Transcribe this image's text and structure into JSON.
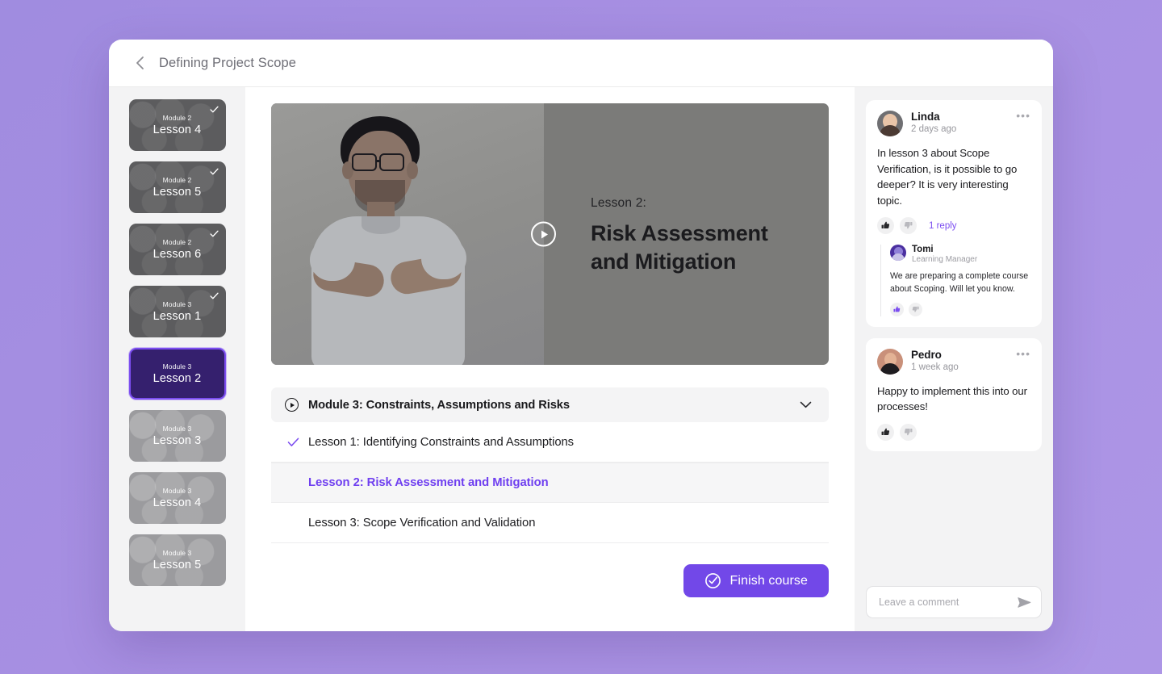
{
  "theme": {
    "page_background": "#a78fe2",
    "accent_purple": "#7248e8",
    "link_purple": "#7b4df0",
    "active_thumb_fill": "#35206e",
    "active_thumb_border": "#7b4df0",
    "sidebar_background": "#f3f3f4",
    "card_background": "#ffffff"
  },
  "header": {
    "back_icon": "chevron-left-icon",
    "title": "Defining Project Scope"
  },
  "sidebar": {
    "lessons": [
      {
        "module": "Module 2",
        "lesson": "Lesson 4",
        "state": "done"
      },
      {
        "module": "Module 2",
        "lesson": "Lesson 5",
        "state": "done"
      },
      {
        "module": "Module 2",
        "lesson": "Lesson 6",
        "state": "done"
      },
      {
        "module": "Module 3",
        "lesson": "Lesson 1",
        "state": "done"
      },
      {
        "module": "Module 3",
        "lesson": "Lesson 2",
        "state": "active"
      },
      {
        "module": "Module 3",
        "lesson": "Lesson 3",
        "state": "locked"
      },
      {
        "module": "Module 3",
        "lesson": "Lesson 4",
        "state": "locked"
      },
      {
        "module": "Module 3",
        "lesson": "Lesson 5",
        "state": "locked"
      }
    ]
  },
  "player": {
    "play_icon": "play-icon",
    "eyebrow": "Lesson 2:",
    "title_line1": "Risk Assessment",
    "title_line2": "and Mitigation"
  },
  "module": {
    "icon": "play-circle-icon",
    "title": "Module 3: Constraints, Assumptions and Risks",
    "toggle_icon": "chevron-down-icon",
    "lessons": [
      {
        "label": "Lesson 1: Identifying Constraints and Assumptions",
        "state": "completed"
      },
      {
        "label": "Lesson 2: Risk Assessment and Mitigation",
        "state": "current"
      },
      {
        "label": "Lesson 3: Scope Verification and Validation",
        "state": "upcoming"
      }
    ]
  },
  "footer": {
    "finish_icon": "circle-check-icon",
    "finish_label": "Finish course"
  },
  "comments": {
    "items": [
      {
        "author": "Linda",
        "time": "2 days ago",
        "avatar": "linda-avatar",
        "text": "In lesson 3 about Scope Verification, is it possible to go deeper? It is very interesting topic.",
        "like_icon": "thumbs-up-icon",
        "dislike_icon": "thumbs-down-icon",
        "reply_count_label": "1 reply",
        "more_icon": "more-options-icon",
        "reply": {
          "author": "Tomi",
          "role": "Learning Manager",
          "avatar": "tomi-avatar",
          "text": "We are preparing a complete course about Scoping. Will let you know.",
          "like_icon": "thumbs-up-icon",
          "dislike_icon": "thumbs-down-icon"
        }
      },
      {
        "author": "Pedro",
        "time": "1 week ago",
        "avatar": "pedro-avatar",
        "text": "Happy to implement this into our processes!",
        "like_icon": "thumbs-up-icon",
        "dislike_icon": "thumbs-down-icon",
        "more_icon": "more-options-icon"
      }
    ],
    "input": {
      "placeholder": "Leave a comment",
      "value": "",
      "send_icon": "send-icon"
    }
  }
}
